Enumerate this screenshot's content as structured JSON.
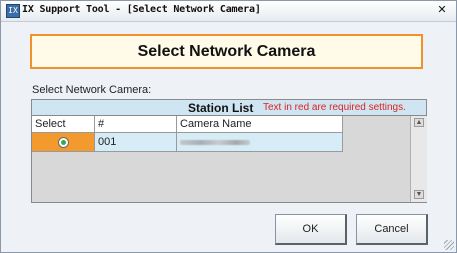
{
  "window": {
    "title": "IX Support Tool - [Select Network Camera]",
    "app_icon_label": "IX",
    "close_glyph": "✕"
  },
  "header": {
    "title": "Select Network Camera"
  },
  "section_label": "Select Network Camera:",
  "station_list": {
    "title": "Station List",
    "note": "Text in red are required settings.",
    "note_color": "#e02020",
    "columns": [
      "Select",
      "#",
      "Camera Name"
    ],
    "rows": [
      {
        "selected": true,
        "number": "001",
        "camera_name_obscured": true
      }
    ],
    "selection_color": "#f29a2e"
  },
  "buttons": {
    "ok_label": "OK",
    "cancel_label": "Cancel"
  },
  "scroll": {
    "up_glyph": "▲",
    "down_glyph": "▼"
  },
  "icons": [
    "app-icon",
    "close-icon",
    "radio-selected-icon",
    "scroll-up-icon",
    "scroll-down-icon",
    "resize-grip-icon"
  ]
}
